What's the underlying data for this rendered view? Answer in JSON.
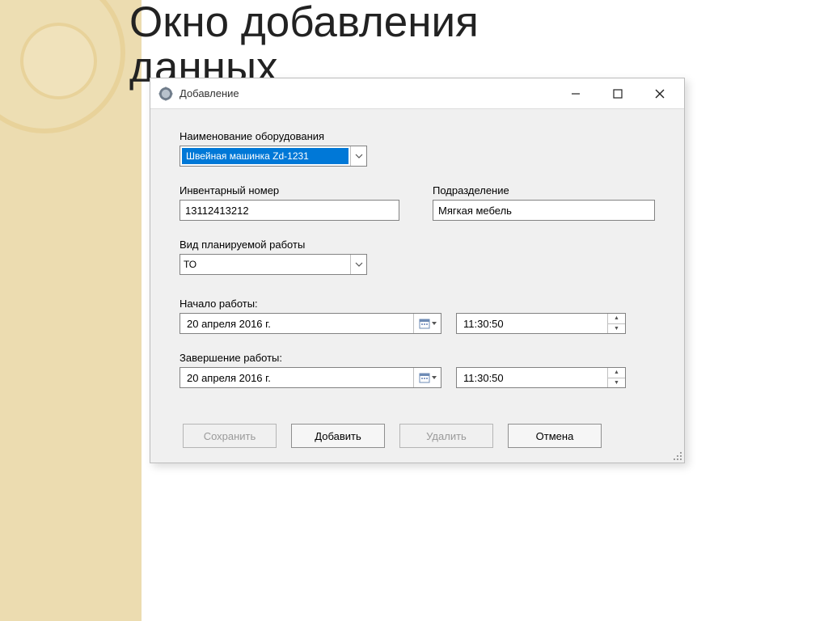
{
  "slide": {
    "title_line1": "Окно добавления",
    "title_line2": "данных"
  },
  "window": {
    "title": "Добавление",
    "equipment": {
      "label": "Наименование оборудования",
      "value": "Швейная машинка Zd-1231"
    },
    "inventory": {
      "label": "Инвентарный номер",
      "value": "13112413212"
    },
    "department": {
      "label": "Подразделение",
      "value": "Мягкая мебель"
    },
    "worktype": {
      "label": "Вид планируемой работы",
      "value": "ТО"
    },
    "start": {
      "label": "Начало работы:",
      "date": "20  апреля  2016 г.",
      "time": "11:30:50"
    },
    "end": {
      "label": "Завершение работы:",
      "date": "20  апреля  2016 г.",
      "time": "11:30:50"
    },
    "buttons": {
      "save": "Сохранить",
      "add": "Добавить",
      "delete": "Удалить",
      "cancel": "Отмена"
    }
  }
}
